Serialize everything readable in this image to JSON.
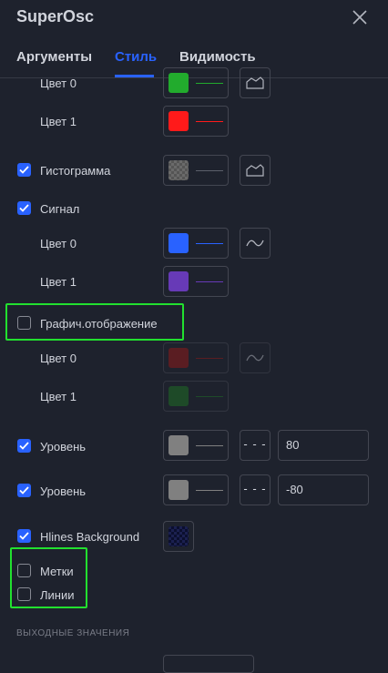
{
  "dialog": {
    "title": "SuperOsc"
  },
  "tabs": [
    {
      "label": "Аргументы",
      "active": false
    },
    {
      "label": "Стиль",
      "active": true
    },
    {
      "label": "Видимость",
      "active": false
    }
  ],
  "rows": {
    "color0_a": {
      "label": "Цвет 0",
      "color": "#22ab2d",
      "line_color": "#22ab2d"
    },
    "color1_a": {
      "label": "Цвет 1",
      "color": "#ff1a1a",
      "line_color": "#ff1a1a"
    },
    "histogram": {
      "label": "Гистограмма",
      "checked": true
    },
    "signal": {
      "label": "Сигнал",
      "checked": true
    },
    "color0_b": {
      "label": "Цвет 0",
      "color": "#2962ff",
      "line_color": "#2962ff"
    },
    "color1_b": {
      "label": "Цвет 1",
      "color": "#673ab7",
      "line_color": "#673ab7"
    },
    "graph": {
      "label": "Графич.отображение",
      "checked": false
    },
    "color0_c": {
      "label": "Цвет 0",
      "color": "#8b1a1a",
      "line_color": "#8b1a1a"
    },
    "color1_c": {
      "label": "Цвет 1",
      "color": "#1f6b24",
      "line_color": "#1f6b24"
    },
    "level1": {
      "label": "Уровень",
      "checked": true,
      "color": "#808080",
      "value": "80"
    },
    "level2": {
      "label": "Уровень",
      "checked": true,
      "color": "#808080",
      "value": "-80"
    },
    "hlines": {
      "label": "Hlines Background",
      "checked": true
    },
    "marks": {
      "label": "Метки",
      "checked": false
    },
    "lines": {
      "label": "Линии",
      "checked": false
    }
  },
  "section": {
    "label": "ВЫХОДНЫЕ ЗНАЧЕНИЯ"
  },
  "colors": {
    "accent": "#2962ff",
    "highlight": "#22e02f",
    "background": "#1e222d"
  }
}
